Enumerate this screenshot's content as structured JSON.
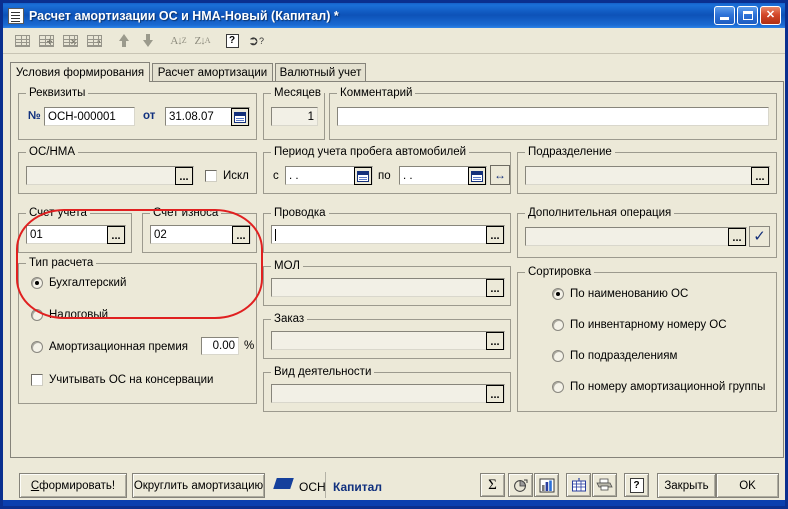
{
  "window": {
    "title": "Расчет амортизации ОС и НМА-Новый (Капитал) *",
    "icon": "document-icon",
    "minimize_label": "",
    "maximize_label": "",
    "close_label": "✕"
  },
  "toolbar": {
    "items": [
      {
        "name": "table-icon",
        "label": ""
      },
      {
        "name": "table-add-icon",
        "label": "+"
      },
      {
        "name": "table-delete-icon",
        "label": "×"
      },
      {
        "name": "table-copy-icon",
        "label": ""
      },
      {
        "name": "move-up-icon",
        "label": ""
      },
      {
        "name": "move-down-icon",
        "label": ""
      },
      {
        "name": "sort-ascending-icon",
        "label": "A\\nZ"
      },
      {
        "name": "sort-descending-icon",
        "label": "Z\\nA"
      },
      {
        "name": "help-icon",
        "label": "?"
      },
      {
        "name": "context-help-icon",
        "label": "?"
      }
    ]
  },
  "tabs": [
    {
      "label": "Условия формирования",
      "active": true
    },
    {
      "label": "Расчет амортизации",
      "active": false
    },
    {
      "label": "Валютный учет",
      "active": false
    }
  ],
  "requisites": {
    "caption": "Реквизиты",
    "number_label": "№",
    "number_value": "ОСН-000001",
    "from_label": "от",
    "date_value": "31.08.07",
    "calendar_icon": "calendar-icon"
  },
  "months": {
    "caption": "Месяцев",
    "value": "1"
  },
  "comment": {
    "caption": "Комментарий",
    "value": ""
  },
  "os_nma": {
    "caption": "ОС/НМА",
    "value": "",
    "browse_label": "...",
    "exclude_label": "Искл",
    "exclude_checked": false
  },
  "mileage_period": {
    "caption": "Период учета пробега автомобилей",
    "from_label": "с",
    "from_value": "  .  .",
    "to_label": "по",
    "to_value": "  .  .",
    "expand_label": "↔"
  },
  "division": {
    "caption": "Подразделение",
    "value": "",
    "browse_label": "..."
  },
  "account_reg": {
    "caption": "Счет учета",
    "value": "01",
    "browse_label": "..."
  },
  "account_wear": {
    "caption": "Счет износа",
    "value": "02",
    "browse_label": "..."
  },
  "calc_type": {
    "caption": "Тип расчета",
    "options": [
      {
        "label": "Бухгалтерский",
        "selected": true
      },
      {
        "label": "Налоговый",
        "selected": false
      },
      {
        "label": "Амортизационная премия",
        "selected": false
      }
    ],
    "premium_value": "0.00",
    "premium_unit": "%",
    "conservation_label": "Учитывать ОС на консервации",
    "conservation_checked": false
  },
  "posting": {
    "caption": "Проводка",
    "value": "",
    "browse_label": "..."
  },
  "mol": {
    "caption": "МОЛ",
    "value": "",
    "browse_label": "..."
  },
  "order": {
    "caption": "Заказ",
    "value": "",
    "browse_label": "..."
  },
  "activity_kind": {
    "caption": "Вид деятельности",
    "value": "",
    "browse_label": "..."
  },
  "extra_operation": {
    "caption": "Дополнительная операция",
    "value": "",
    "browse_label": "...",
    "confirm_label": "✓"
  },
  "sorting": {
    "caption": "Сортировка",
    "options": [
      {
        "label": "По наименованию ОС",
        "selected": true
      },
      {
        "label": "По инвентарному номеру ОС",
        "selected": false
      },
      {
        "label": "По подразделениям",
        "selected": false
      },
      {
        "label": "По номеру амортизационной группы",
        "selected": false
      }
    ]
  },
  "footer": {
    "generate_label": "Сформировать!",
    "generate_accesskey": "С",
    "round_label": "Округлить амортизацию",
    "osn_label": "ОСН",
    "osn_icon": "flag-icon",
    "capital_label": "Капитал",
    "icons": [
      {
        "name": "sum-icon",
        "label": "Σ"
      },
      {
        "name": "pie-chart-icon",
        "label": ""
      },
      {
        "name": "bar-chart-icon",
        "label": ""
      },
      {
        "name": "spreadsheet-icon",
        "label": ""
      },
      {
        "name": "print-icon",
        "label": ""
      },
      {
        "name": "help-icon",
        "label": "?"
      }
    ],
    "close_label": "Закрыть",
    "ok_label": "OK"
  },
  "colors": {
    "titlebar": "#0d52b8",
    "face": "#ece9d8",
    "highlight_oval": "#e02020",
    "accent_blue": "#10307e",
    "statusbar": "#0a3faf"
  }
}
